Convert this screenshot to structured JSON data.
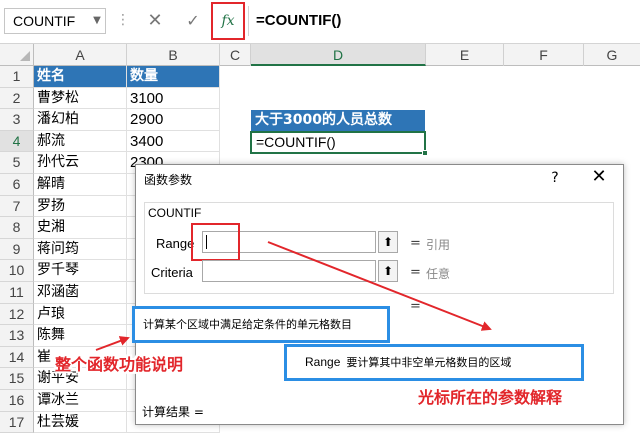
{
  "formula_bar": {
    "name_box": "COUNTIF",
    "name_box_arrow": "▼",
    "cancel": "✕",
    "enter": "✓",
    "fx": "fx",
    "formula": "=COUNTIF()"
  },
  "columns": [
    "A",
    "B",
    "C",
    "D",
    "E",
    "F",
    "G"
  ],
  "rows": [
    "1",
    "2",
    "3",
    "4",
    "5",
    "6",
    "7",
    "8",
    "9",
    "10",
    "11",
    "12",
    "13",
    "14",
    "15",
    "16",
    "17"
  ],
  "selected_row": "4",
  "selected_column": "D",
  "sheet": {
    "header_name": "姓名",
    "header_qty": "数量",
    "names": [
      "曹梦松",
      "潘幻柏",
      "郝流",
      "孙代云",
      "解晴",
      "罗扬",
      "史湘",
      "蒋问筠",
      "罗千琴",
      "邓涵菡",
      "卢琅",
      "陈舞",
      "崔",
      "谢平安",
      "谭冰兰",
      "杜芸媛"
    ],
    "quantities": [
      "3100",
      "2900",
      "3400",
      "2300",
      "",
      "",
      "",
      "",
      "",
      "",
      "",
      "",
      "",
      "",
      "",
      ""
    ],
    "d3": "大于3000的人员总数",
    "d4": "=COUNTIF()"
  },
  "dialog": {
    "title": "函数参数",
    "help": "?",
    "close": "✕",
    "function_name": "COUNTIF",
    "args": [
      {
        "label": "Range",
        "value": "",
        "equals": "=",
        "hint": "引用",
        "ref_icon": "⬆"
      },
      {
        "label": "Criteria",
        "value": "",
        "equals": "=",
        "hint": "任意",
        "ref_icon": "⬆"
      }
    ],
    "result_equals": "=",
    "description": "计算某个区域中满足给定条件的单元格数目",
    "arg_name": "Range",
    "arg_description": "要计算其中非空单元格数目的区域",
    "result_label": "计算结果 ="
  },
  "annotations": {
    "function_desc": "整个函数功能说明",
    "arg_desc": "光标所在的参数解释"
  },
  "colors": {
    "header_blue": "#2e75b6",
    "annotation_red": "#e2262b",
    "callout_blue": "#2b8ee4",
    "excel_green": "#217346"
  }
}
